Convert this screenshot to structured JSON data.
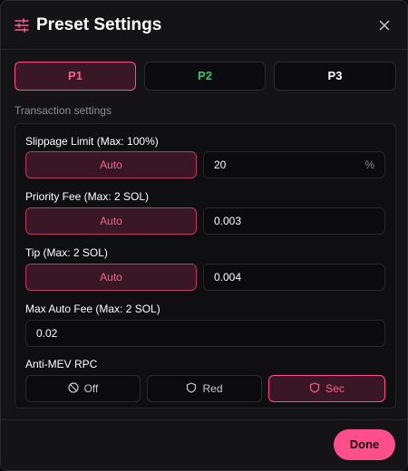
{
  "header": {
    "title": "Preset Settings",
    "icon": "sliders-icon",
    "close_icon": "close-icon"
  },
  "tabs": [
    {
      "label": "P1",
      "active": true,
      "color": "#ff5c98"
    },
    {
      "label": "P2",
      "active": false,
      "color": "#2ec971"
    },
    {
      "label": "P3",
      "active": false,
      "color": "#ffffff"
    }
  ],
  "section": {
    "label": "Transaction settings"
  },
  "fields": {
    "slippage": {
      "label": "Slippage Limit (Max: 100%)",
      "button": "Auto",
      "value": "20",
      "unit": "%"
    },
    "priority_fee": {
      "label": "Priority Fee (Max: 2 SOL)",
      "button": "Auto",
      "value": "0.003"
    },
    "tip": {
      "label": "Tip (Max: 2 SOL)",
      "button": "Auto",
      "value": "0.004"
    },
    "max_auto_fee": {
      "label": "Max Auto Fee (Max: 2 SOL)",
      "value": "0.02"
    }
  },
  "anti_mev": {
    "label": "Anti-MEV RPC",
    "options": [
      {
        "label": "Off",
        "icon": "ban-icon",
        "active": false
      },
      {
        "label": "Red",
        "icon": "shield-icon",
        "active": false
      },
      {
        "label": "Sec",
        "icon": "shield-icon",
        "active": true
      }
    ]
  },
  "footer": {
    "done_label": "Done"
  },
  "colors": {
    "accent": "#ff4f8b",
    "accent_text": "#ff5c98",
    "success": "#2ec971",
    "background": "#141417"
  }
}
